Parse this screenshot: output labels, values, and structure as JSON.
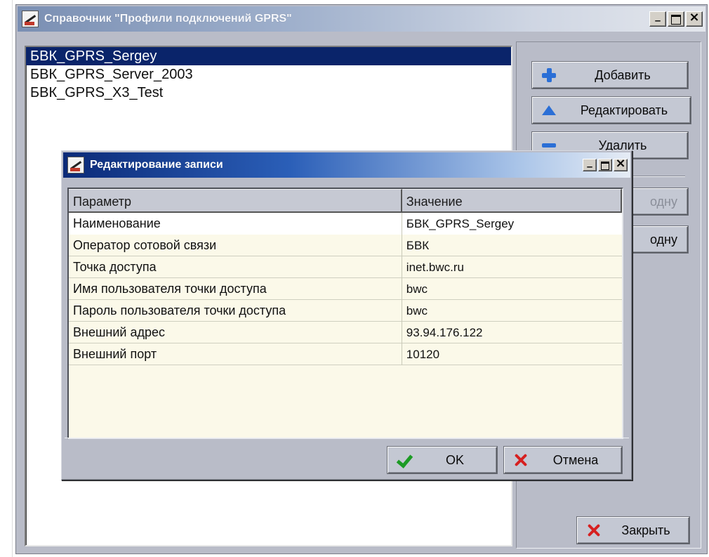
{
  "main_window": {
    "title": "Справочник \"Профили подключений GPRS\"",
    "profiles": [
      "БВК_GPRS_Sergey",
      "БВК_GPRS_Server_2003",
      "БВК_GPRS_X3_Test"
    ],
    "selected_index": 0,
    "buttons": {
      "add": "Добавить",
      "edit": "Редактировать",
      "delete": "Удалить",
      "partial_1": "одну",
      "partial_2": "одну",
      "close": "Закрыть"
    }
  },
  "edit_dialog": {
    "title": "Редактирование записи",
    "columns": {
      "param": "Параметр",
      "value": "Значение"
    },
    "rows": [
      {
        "param": "Наименование",
        "value": "БВК_GPRS_Sergey"
      },
      {
        "param": "Оператор сотовой связи",
        "value": "БВК"
      },
      {
        "param": "Точка доступа",
        "value": "inet.bwc.ru"
      },
      {
        "param": "Имя пользователя точки доступа",
        "value": "bwc"
      },
      {
        "param": "Пароль пользователя точки доступа",
        "value": "bwc"
      },
      {
        "param": "Внешний адрес",
        "value": "93.94.176.122"
      },
      {
        "param": "Внешний порт",
        "value": "10120"
      }
    ],
    "buttons": {
      "ok": "OK",
      "cancel": "Отмена"
    }
  },
  "colors": {
    "selection": "#0a246a",
    "window_face": "#b9bcc8",
    "grid_background": "#fbf9e9",
    "icon_blue": "#2b6fd6",
    "icon_red": "#d62020",
    "icon_green": "#1c9b25"
  }
}
